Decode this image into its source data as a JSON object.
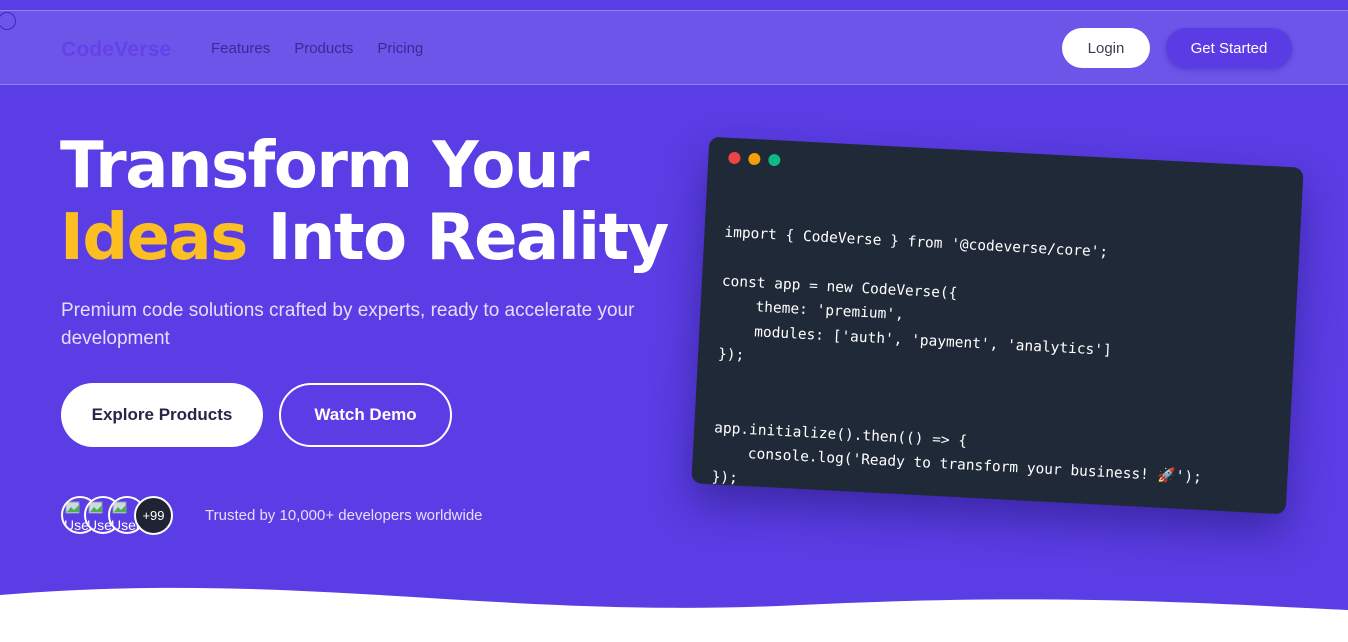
{
  "brand": {
    "name": "CodeVerse"
  },
  "nav": {
    "links": [
      "Features",
      "Products",
      "Pricing"
    ],
    "login_label": "Login",
    "get_started_label": "Get Started"
  },
  "hero": {
    "headline_line1": "Transform Your",
    "headline_accent": "Ideas",
    "headline_rest": " Into Reality",
    "subtitle": "Premium code solutions crafted by experts, ready to accelerate your development",
    "explore_label": "Explore Products",
    "demo_label": "Watch Demo",
    "avatar_alt": "User",
    "avatar_more": "+99",
    "trusted_text": "Trusted by 10,000+ developers worldwide"
  },
  "code_window": {
    "lines": [
      "import { CodeVerse } from '@codeverse/core';",
      "",
      "const app = new CodeVerse({",
      "    theme: 'premium',",
      "    modules: ['auth', 'payment', 'analytics']",
      "});",
      "",
      "",
      "app.initialize().then(() => {",
      "    console.log('Ready to transform your business! 🚀');",
      "});"
    ]
  },
  "colors": {
    "hero_bg": "#5a3de4",
    "navbar_bg": "#6d55ea",
    "accent_yellow": "#fbbf24",
    "code_bg": "#1f2937",
    "dot_red": "#ef4444",
    "dot_yellow": "#f59e0b",
    "dot_green": "#10b981"
  }
}
